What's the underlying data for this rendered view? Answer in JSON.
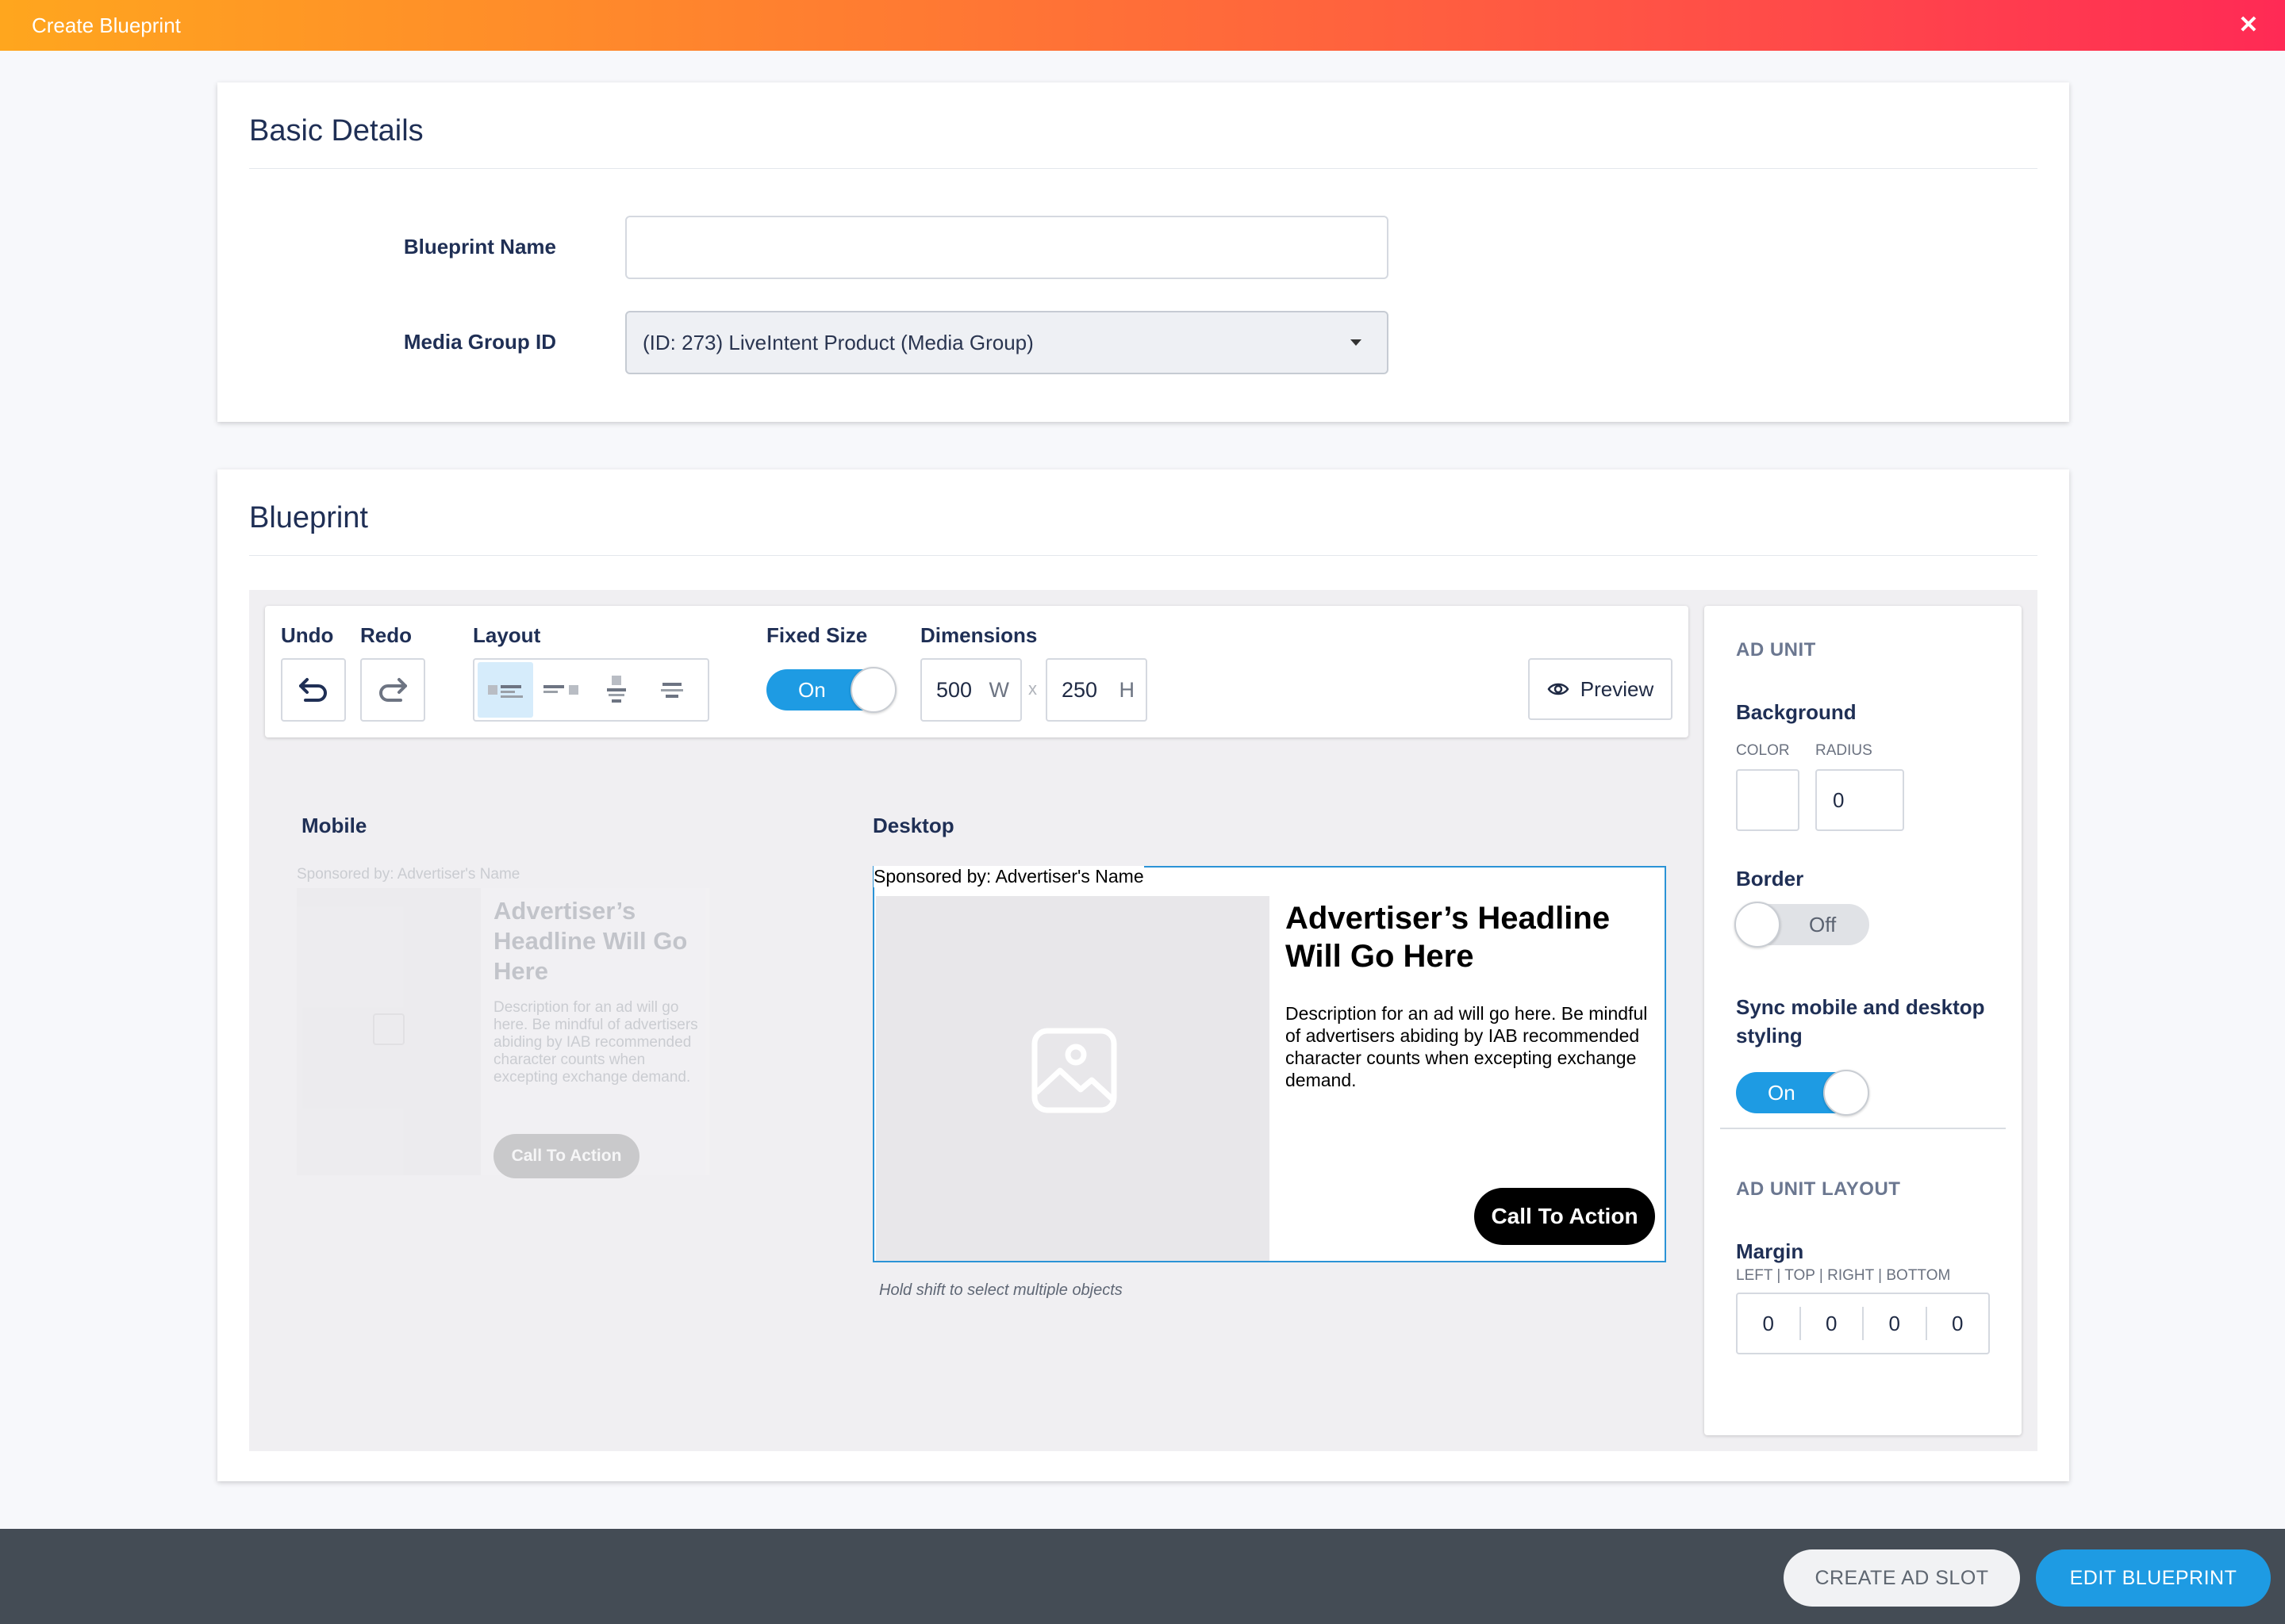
{
  "window": {
    "title": "Create Blueprint",
    "close_glyph": "✕"
  },
  "basic_details": {
    "heading": "Basic Details",
    "blueprint_name_label": "Blueprint Name",
    "blueprint_name_value": "",
    "media_group_label": "Media Group ID",
    "media_group_value": "(ID: 273) LiveIntent Product (Media Group)"
  },
  "blueprint": {
    "heading": "Blueprint",
    "toolbar": {
      "undo_label": "Undo",
      "redo_label": "Redo",
      "layout_label": "Layout",
      "fixed_size_label": "Fixed Size",
      "fixed_size_state": "On",
      "dimensions_label": "Dimensions",
      "width_value": "500",
      "width_unit": "W",
      "separator": "x",
      "height_value": "250",
      "height_unit": "H",
      "preview_label": "Preview"
    },
    "mobile_label": "Mobile",
    "desktop_label": "Desktop",
    "ad": {
      "sponsor": "Sponsored by: Advertiser's Name",
      "headline": "Advertiser’s Headline Will Go Here",
      "description": "Description for an ad will go here. Be mindful of advertisers abiding by IAB recommended character counts when excepting exchange demand.",
      "cta": "Call To Action"
    },
    "hint": "Hold shift to select multiple objects"
  },
  "properties": {
    "ad_unit_heading": "AD UNIT",
    "background_label": "Background",
    "color_label": "COLOR",
    "radius_label": "RADIUS",
    "radius_value": "0",
    "border_label": "Border",
    "border_state": "Off",
    "sync_label": "Sync mobile and desktop styling",
    "sync_state": "On",
    "layout_heading": "AD UNIT LAYOUT",
    "margin_label": "Margin",
    "margin_sides_label": "LEFT | TOP | RIGHT | BOTTOM",
    "margin_left": "0",
    "margin_top": "0",
    "margin_right": "0",
    "margin_bottom": "0"
  },
  "footer": {
    "create_ad_slot_label": "CREATE AD SLOT",
    "edit_blueprint_label": "EDIT BLUEPRINT"
  },
  "colors": {
    "accent": "#1e9be3",
    "header_gradient_start": "#ffa61e",
    "header_gradient_end": "#ff2a55",
    "footer_bg": "#444c55"
  },
  "icons": [
    "close-icon",
    "undo-icon",
    "redo-icon",
    "layout-image-left-icon",
    "layout-image-right-icon",
    "layout-image-top-icon",
    "layout-text-only-icon",
    "eye-icon",
    "image-placeholder-icon",
    "dropdown-caret-icon"
  ]
}
